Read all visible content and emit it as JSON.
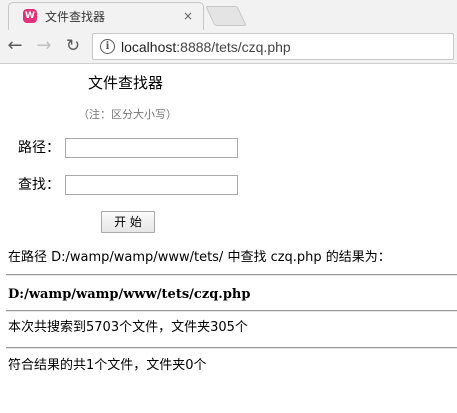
{
  "browser": {
    "tab_title": "文件查找器",
    "favicon_glyph": "W",
    "tab_close": "×",
    "url_host": "localhost",
    "url_rest": ":8888/tets/czq.php"
  },
  "icons": {
    "back": "←",
    "forward": "→",
    "reload": "↻",
    "info": "i"
  },
  "colors": {
    "favicon": "#e0317a",
    "chrome_bg": "#f2f2f2"
  },
  "form": {
    "title": "文件查找器",
    "note": "（注：区分大小写）",
    "path_label": "路径：",
    "path_value": "",
    "find_label": "查找：",
    "find_value": "",
    "start_button": "开 始"
  },
  "results": {
    "intro": "在路径 D:/wamp/wamp/www/tets/ 中查找 czq.php 的结果为：",
    "found_path": "D:/wamp/wamp/www/tets/czq.php",
    "search_summary": "本次共搜索到5703个文件，文件夹305个",
    "match_summary": "符合结果的共1个文件，文件夹0个"
  }
}
